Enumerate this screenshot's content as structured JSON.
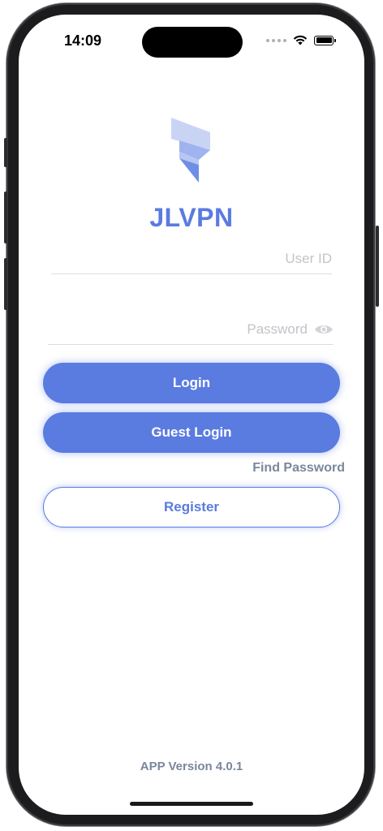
{
  "status_bar": {
    "time": "14:09"
  },
  "app": {
    "name": "JLVPN",
    "brand_color": "#5a7be0",
    "logo_icon": "jlvpn-logo-icon"
  },
  "form": {
    "user_id_placeholder": "User ID",
    "user_id_value": "",
    "password_placeholder": "Password",
    "password_value": "",
    "password_toggle_icon": "eye-icon"
  },
  "buttons": {
    "login_label": "Login",
    "guest_login_label": "Guest Login",
    "find_password_label": "Find Password",
    "register_label": "Register"
  },
  "footer": {
    "version_text": "APP Version 4.0.1"
  }
}
